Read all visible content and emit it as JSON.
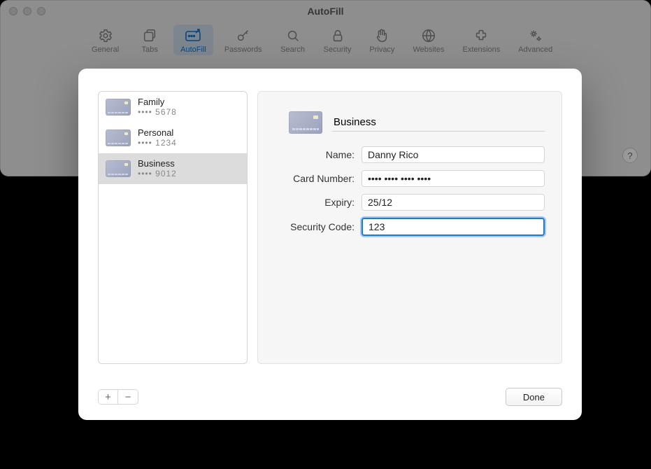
{
  "window": {
    "title": "AutoFill",
    "helpLabel": "?"
  },
  "toolbar": {
    "items": [
      {
        "label": "General",
        "iconName": "gear-icon"
      },
      {
        "label": "Tabs",
        "iconName": "tabs-icon"
      },
      {
        "label": "AutoFill",
        "iconName": "autofill-icon",
        "active": true
      },
      {
        "label": "Passwords",
        "iconName": "key-icon"
      },
      {
        "label": "Search",
        "iconName": "search-icon"
      },
      {
        "label": "Security",
        "iconName": "lock-icon"
      },
      {
        "label": "Privacy",
        "iconName": "hand-icon"
      },
      {
        "label": "Websites",
        "iconName": "globe-icon"
      },
      {
        "label": "Extensions",
        "iconName": "puzzle-icon"
      },
      {
        "label": "Advanced",
        "iconName": "gears-icon"
      }
    ]
  },
  "cards": [
    {
      "title": "Family",
      "masked": "•••• 5678",
      "selected": false
    },
    {
      "title": "Personal",
      "masked": "•••• 1234",
      "selected": false
    },
    {
      "title": "Business",
      "masked": "•••• 9012",
      "selected": true
    }
  ],
  "detail": {
    "title": "Business",
    "fields": {
      "nameLabel": "Name:",
      "nameValue": "Danny Rico",
      "numberLabel": "Card Number:",
      "numberValue": "•••• •••• •••• ••••",
      "expiryLabel": "Expiry:",
      "expiryValue": "25/12",
      "codeLabel": "Security Code:",
      "codeValue": "123"
    }
  },
  "buttons": {
    "add": "+",
    "remove": "−",
    "done": "Done"
  }
}
